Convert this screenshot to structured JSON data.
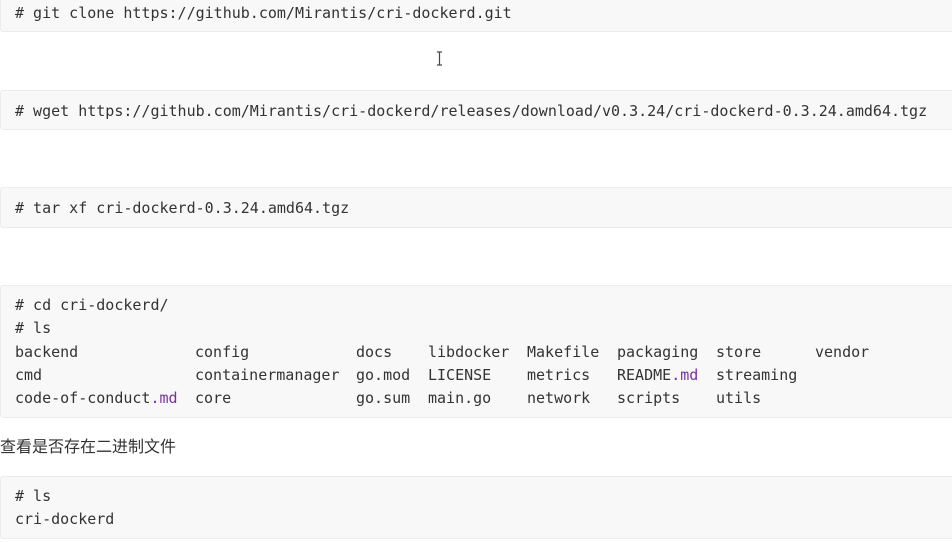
{
  "blocks": {
    "clone": {
      "line": "# git clone https://github.com/Mirantis/cri-dockerd.git"
    },
    "wget": {
      "line": "# wget https://github.com/Mirantis/cri-dockerd/releases/download/v0.3.24/cri-dockerd-0.3.24.amd64.tgz"
    },
    "tar": {
      "line": "# tar xf cri-dockerd-0.3.24.amd64.tgz"
    },
    "listing": {
      "cmd_cd": "# cd cri-dockerd/",
      "cmd_ls": "# ls",
      "files": {
        "r1": [
          "backend",
          "config",
          "docs",
          "libdocker",
          "Makefile",
          "packaging",
          "store",
          "vendor"
        ],
        "r2": [
          "cmd",
          "containermanager",
          "go.mod",
          "LICENSE",
          "metrics",
          "README",
          "streaming"
        ],
        "r3": [
          "code-of-conduct",
          "core",
          "go.sum",
          "main.go",
          "network",
          "scripts",
          "utils"
        ],
        "ext": ".md"
      }
    },
    "check": {
      "cmd_ls": "# ls",
      "output": "cri-dockerd"
    }
  },
  "prose": {
    "check_binary": "查看是否存在二进制文件"
  },
  "colors": {
    "block_bg": "#f8f8f8",
    "text": "#333333",
    "md_extension": "#7a2ea0"
  },
  "icons": {
    "cursor": "text-cursor-icon"
  }
}
